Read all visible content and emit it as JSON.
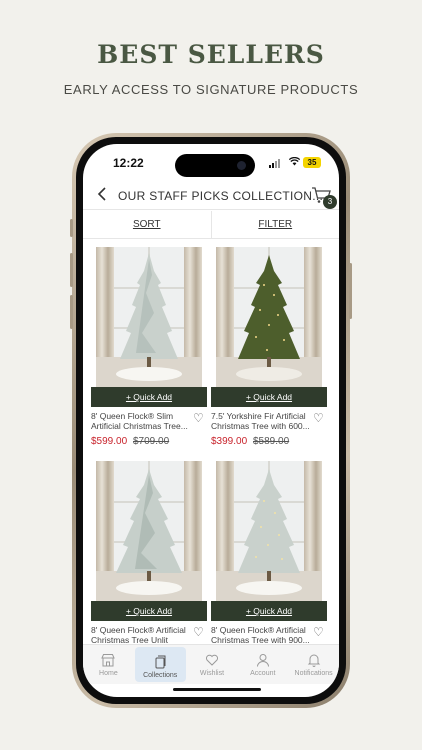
{
  "hero": {
    "title": "BEST SELLERS",
    "subtitle": "EARLY ACCESS TO SIGNATURE PRODUCTS"
  },
  "status_bar": {
    "time": "12:22",
    "battery": "35"
  },
  "nav": {
    "title": "OUR STAFF PICKS COLLECTION...",
    "cart_count": "3",
    "icons": [
      "chevron-left-icon",
      "cart-icon"
    ]
  },
  "toolbar": {
    "sort_label": "SORT",
    "filter_label": "FILTER"
  },
  "products": [
    {
      "name": "8' Queen Flock® Slim Artificial Christmas Tree...",
      "price": "$599.00",
      "old_price": "$709.00",
      "quick_add": "+ Quick Add",
      "tree": "flocked"
    },
    {
      "name": "7.5' Yorkshire Fir Artificial Christmas Tree with 600...",
      "price": "$399.00",
      "old_price": "$589.00",
      "quick_add": "+ Quick Add",
      "tree": "green"
    },
    {
      "name": "8' Queen Flock® Artificial Christmas Tree Unlit",
      "price": "",
      "old_price": "",
      "quick_add": "+ Quick Add",
      "tree": "flocked"
    },
    {
      "name": "8' Queen Flock® Artificial Christmas Tree with 900...",
      "price": "",
      "old_price": "",
      "quick_add": "+ Quick Add",
      "tree": "flocked"
    }
  ],
  "tabbar": {
    "items": [
      {
        "label": "Home",
        "icon": "storefront-icon"
      },
      {
        "label": "Collections",
        "icon": "collections-icon"
      },
      {
        "label": "Wishlist",
        "icon": "heart-icon"
      },
      {
        "label": "Account",
        "icon": "user-icon"
      },
      {
        "label": "Notifications",
        "icon": "bell-icon"
      }
    ],
    "active": "Collections"
  },
  "colors": {
    "background": "#f2f1ec",
    "brand_green": "#2f3b2c",
    "heading_green": "#4a5843",
    "sale_red": "#c8232c",
    "active_tab": "#dde8f3"
  }
}
